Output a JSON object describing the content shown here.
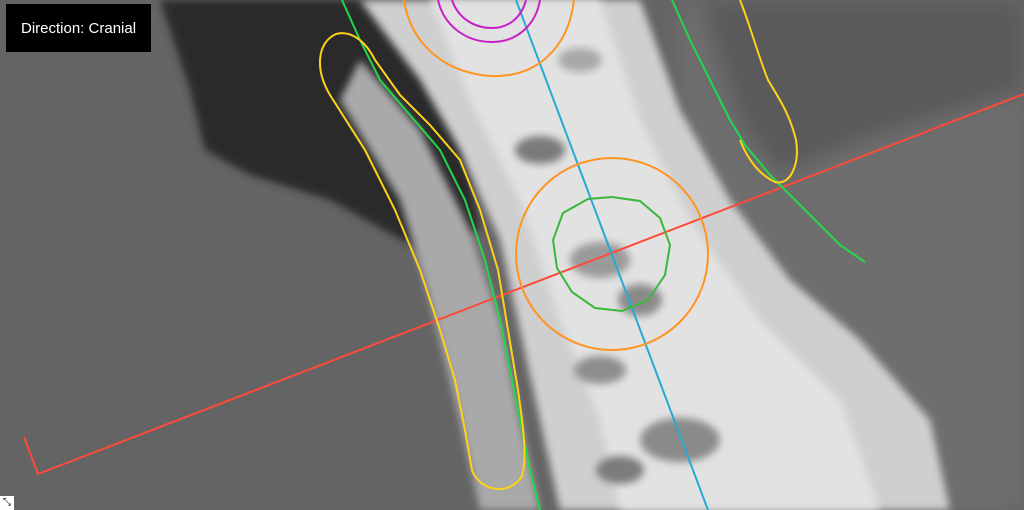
{
  "viewer": {
    "direction_label": "Direction: Cranial",
    "corner_icon": "resize-icon",
    "colors": {
      "reference_line": "#ff4a3a",
      "centerline": "#26a9d6",
      "contour_green": "#22d84a",
      "contour_yellow": "#ffd21a",
      "ring_orange": "#ff9422",
      "ring_green": "#3ab83a",
      "ring_magenta": "#c820c8"
    }
  }
}
